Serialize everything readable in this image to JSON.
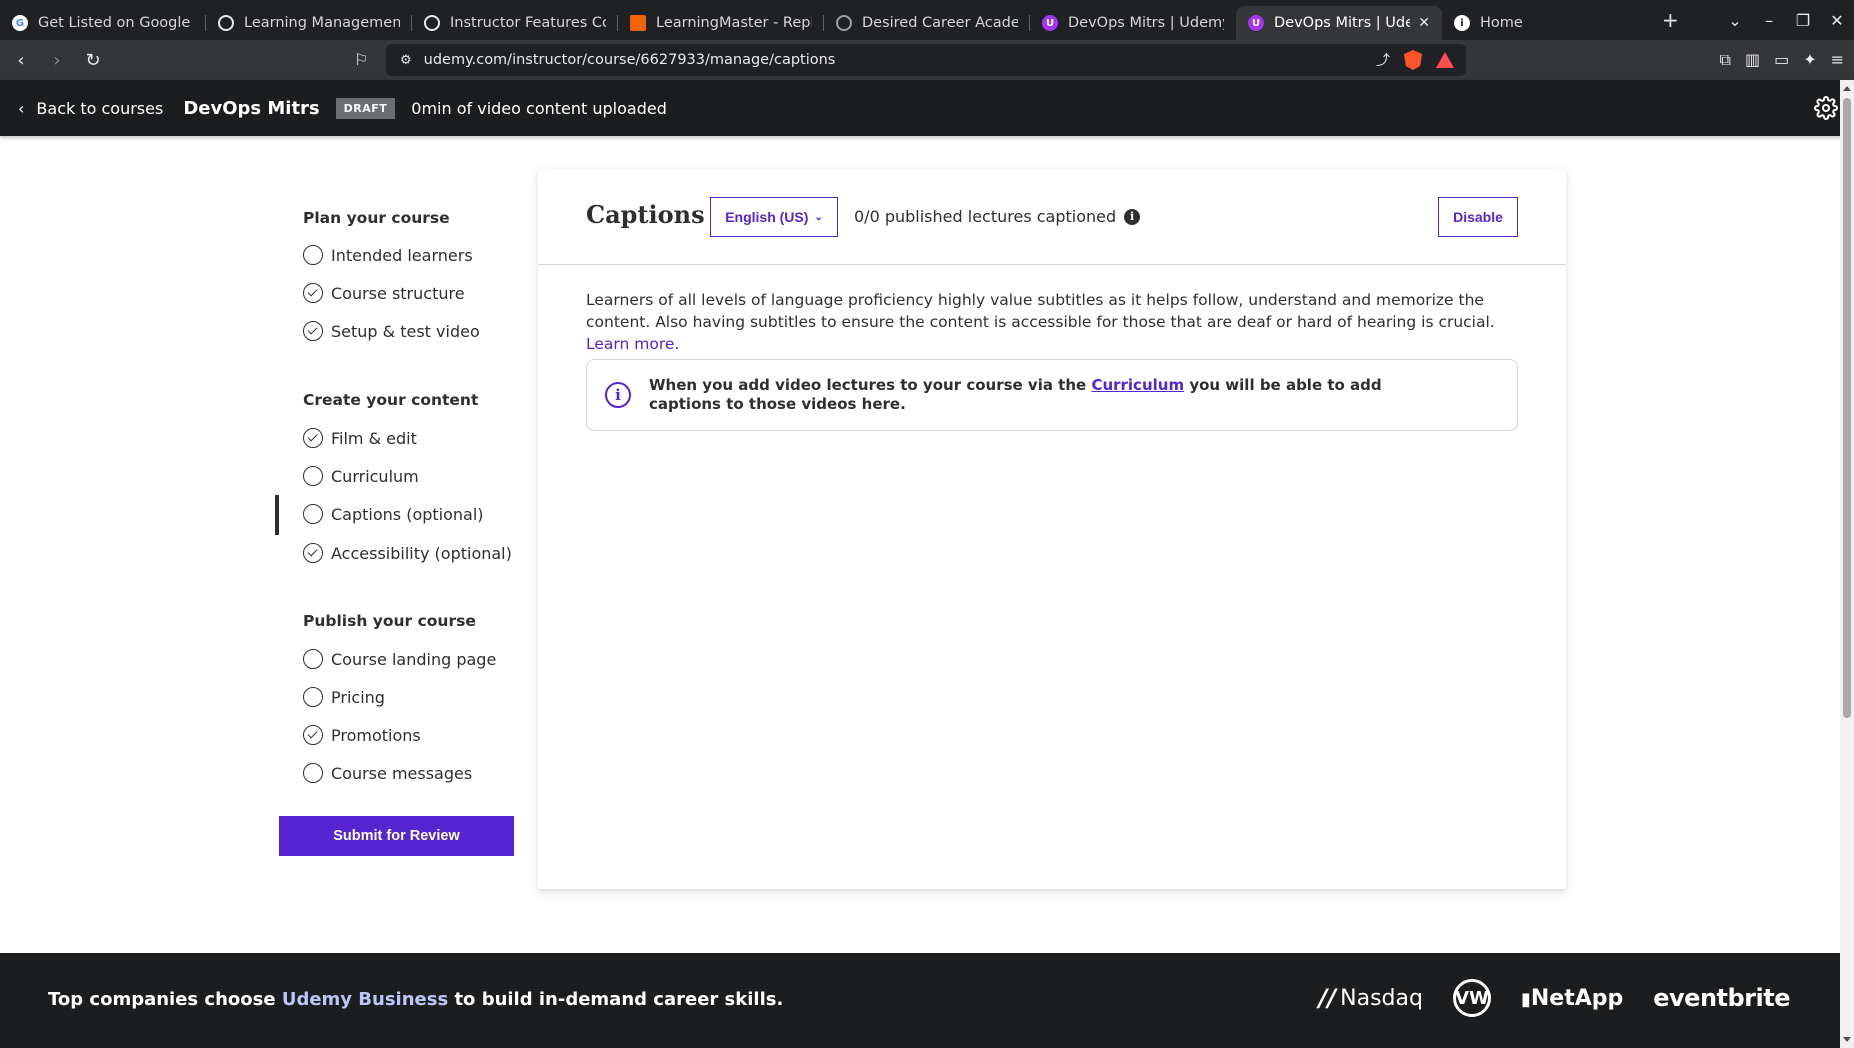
{
  "browser": {
    "tabs": [
      {
        "title": "Get Listed on Google - C",
        "favicon": "google-icon",
        "color": "#ffffff"
      },
      {
        "title": "Learning Management",
        "favicon": "chatgpt-icon",
        "color": "#e8eaed"
      },
      {
        "title": "Instructor Features Co",
        "favicon": "chatgpt-icon",
        "color": "#e8eaed"
      },
      {
        "title": "LearningMaster - Replit",
        "favicon": "replit-icon",
        "color": "#f26207"
      },
      {
        "title": "Desired Career Academ",
        "favicon": "globe-icon",
        "color": "#9aa0a6"
      },
      {
        "title": "DevOps Mitrs | Udemy",
        "favicon": "udemy-icon",
        "color": "#a435f0"
      },
      {
        "title": "DevOps Mitrs | Udemy",
        "favicon": "udemy-icon",
        "color": "#a435f0",
        "active": true
      },
      {
        "title": "Home",
        "favicon": "info-icon",
        "color": "#ffffff"
      }
    ],
    "url": "udemy.com/instructor/course/6627933/manage/captions"
  },
  "header": {
    "back_label": "Back to courses",
    "course_title": "DevOps Mitrs",
    "status_badge": "DRAFT",
    "upload_status": "0min of video content uploaded"
  },
  "sidebar": {
    "sections": [
      {
        "title": "Plan your course",
        "items": [
          {
            "label": "Intended learners",
            "done": false
          },
          {
            "label": "Course structure",
            "done": true
          },
          {
            "label": "Setup & test video",
            "done": true
          }
        ]
      },
      {
        "title": "Create your content",
        "items": [
          {
            "label": "Film & edit",
            "done": true
          },
          {
            "label": "Curriculum",
            "done": false
          },
          {
            "label": "Captions (optional)",
            "done": false,
            "active": true
          },
          {
            "label": "Accessibility (optional)",
            "done": true
          }
        ]
      },
      {
        "title": "Publish your course",
        "items": [
          {
            "label": "Course landing page",
            "done": false
          },
          {
            "label": "Pricing",
            "done": false
          },
          {
            "label": "Promotions",
            "done": true
          },
          {
            "label": "Course messages",
            "done": false
          }
        ]
      }
    ],
    "submit_label": "Submit for Review"
  },
  "main": {
    "title": "Captions",
    "language": "English (US)",
    "captioned_status": "0/0 published lectures captioned",
    "disable_label": "Disable",
    "description": "Learners of all levels of language proficiency highly value subtitles as it helps follow, understand and memorize the content. Also having subtitles to ensure the content is accessible for those that are deaf or hard of hearing is crucial.",
    "learn_more": "Learn more",
    "alert_before": "When you add video lectures to your course via the",
    "alert_link": "Curriculum",
    "alert_after": "you will be able to add captions to those videos here."
  },
  "footer": {
    "text_before": "Top companies choose",
    "text_link": "Udemy Business",
    "text_after": "to build in-demand career skills.",
    "logos": [
      "Nasdaq",
      "VW",
      "NetApp",
      "eventbrite"
    ]
  },
  "colors": {
    "accent": "#5624d0",
    "header_bg": "#1c1d1f",
    "footer_link": "#c0c4fc"
  }
}
